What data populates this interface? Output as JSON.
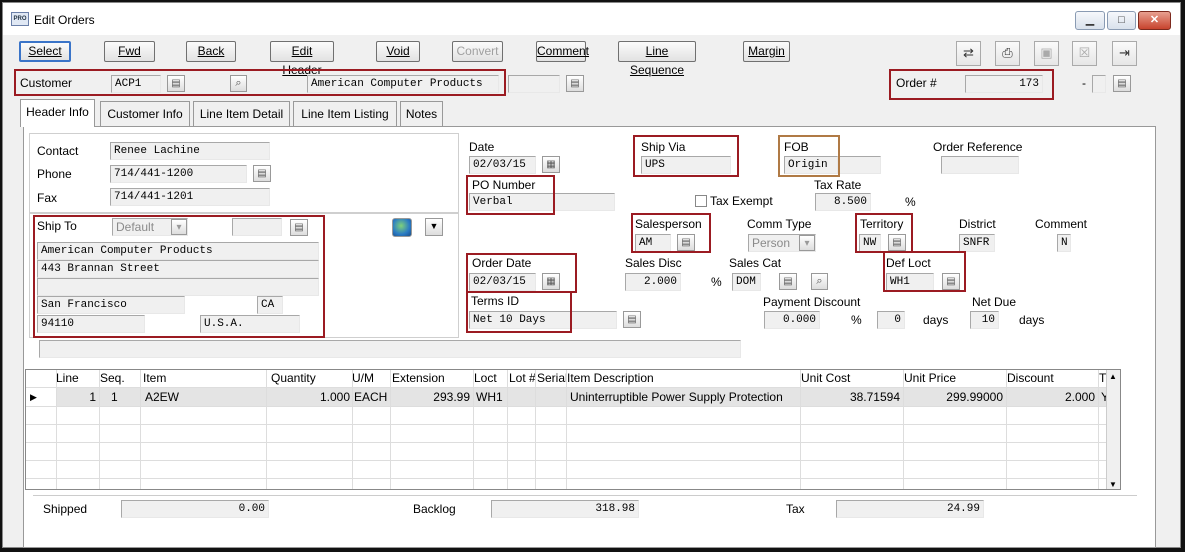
{
  "window": {
    "title": "Edit Orders",
    "app_icon": "PRO",
    "minimize_icon": "minimize-icon",
    "maximize_icon": "maximize-icon",
    "close_icon": "close-icon"
  },
  "toolbar": {
    "select": "Select",
    "fwd": "Fwd",
    "back": "Back",
    "edit_header": "Edit Header",
    "void": "Void",
    "convert": "Convert",
    "comment": "Comment",
    "line_sequence": "Line Sequence",
    "margin": "Margin",
    "icons": [
      "transfer-icon",
      "print-icon",
      "save-icon",
      "delete-icon",
      "exit-icon"
    ]
  },
  "customer": {
    "label": "Customer",
    "code": "ACP1",
    "name": "American Computer Products",
    "extra": ""
  },
  "order": {
    "label": "Order #",
    "number": "173",
    "suffix": "-",
    "suffix_value": ""
  },
  "tabs": [
    {
      "label": "Header Info"
    },
    {
      "label": "Customer Info"
    },
    {
      "label": "Line Item Detail"
    },
    {
      "label": "Line Item Listing"
    },
    {
      "label": "Notes"
    }
  ],
  "contact": {
    "contact_label": "Contact",
    "contact": "Renee Lachine",
    "phone_label": "Phone",
    "phone": "714/441-1200",
    "fax_label": "Fax",
    "fax": "714/441-1201"
  },
  "ship_to": {
    "label": "Ship To",
    "code": "Default",
    "extra": "",
    "line1": "American Computer Products",
    "line2": "443 Brannan Street",
    "line3": "",
    "city": "San Francisco",
    "state": "CA",
    "zip": "94110",
    "country": "U.S.A."
  },
  "header": {
    "date_label": "Date",
    "date": "02/03/15",
    "ship_via_label": "Ship Via",
    "ship_via": "UPS",
    "fob_label": "FOB",
    "fob": "Origin",
    "fob_extra": "",
    "order_ref_label": "Order Reference",
    "order_ref": "",
    "po_label": "PO Number",
    "po": "Verbal",
    "tax_exempt_label": "Tax Exempt",
    "tax_rate_label": "Tax Rate",
    "tax_rate": "8.500",
    "pct": "%",
    "salesperson_label": "Salesperson",
    "salesperson": "AM",
    "comm_type_label": "Comm Type",
    "comm_type": "Person",
    "territory_label": "Territory",
    "territory": "NW",
    "district_label": "District",
    "district": "SNFR",
    "comment_label": "Comment",
    "comment": "N",
    "order_date_label": "Order Date",
    "order_date": "02/03/15",
    "sales_disc_label": "Sales Disc",
    "sales_disc": "2.000",
    "sales_cat_label": "Sales Cat",
    "sales_cat": "DOM",
    "def_loct_label": "Def Loct",
    "def_loct": "WH1",
    "terms_label": "Terms ID",
    "terms": "Net 10 Days",
    "terms_extra": "",
    "pay_disc_label": "Payment Discount",
    "pay_disc": "0.000",
    "pay_days": "0",
    "days": "days",
    "net_due_label": "Net Due",
    "net_due": "10"
  },
  "message": "",
  "grid": {
    "columns": [
      "Line",
      "Seq.",
      "Item",
      "Quantity",
      "U/M",
      "Extension",
      "Loct",
      "Lot #",
      "Serial",
      "Item Description",
      "Unit Cost",
      "Unit Price",
      "Discount",
      "T"
    ],
    "rows": [
      {
        "line": "1",
        "seq": "1",
        "item": "A2EW",
        "qty": "1.000",
        "um": "EACH",
        "ext": "293.99",
        "loct": "WH1",
        "lot": "",
        "serial": "",
        "desc": "Uninterruptible Power Supply Protection",
        "cost": "38.71594",
        "price": "299.99000",
        "disc": "2.000",
        "t": "Y"
      }
    ]
  },
  "footer": {
    "shipped_label": "Shipped",
    "shipped": "0.00",
    "backlog_label": "Backlog",
    "backlog": "318.98",
    "tax_label": "Tax",
    "tax": "24.99"
  }
}
